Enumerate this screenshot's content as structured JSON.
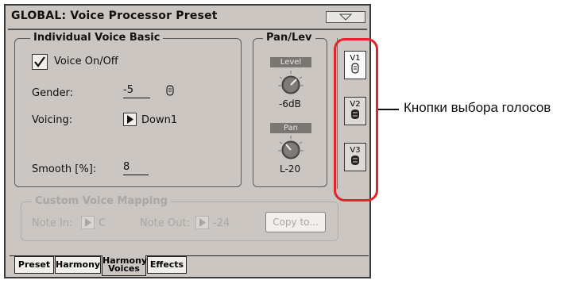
{
  "window": {
    "title": "GLOBAL: Voice Processor Preset",
    "menu_icon": "triangle-down-icon"
  },
  "voice_basic": {
    "title": "Individual Voice Basic",
    "voice_on_off": {
      "label": "Voice On/Off",
      "checked": true
    },
    "gender": {
      "label": "Gender:",
      "value": "-5",
      "icon": "face-icon"
    },
    "voicing": {
      "label": "Voicing:",
      "value": "Down1"
    },
    "smooth": {
      "label": "Smooth [%]:",
      "value": "8"
    }
  },
  "pan_lev": {
    "title": "Pan/Lev",
    "level": {
      "label": "Level",
      "value": "-6dB"
    },
    "pan": {
      "label": "Pan",
      "value": "L-20"
    }
  },
  "custom_mapping": {
    "title": "Custom Voice Mapping",
    "note_in": {
      "label": "Note In:",
      "value": "C"
    },
    "note_out": {
      "label": "Note Out:",
      "value": "-24"
    },
    "copy_button": "Copy to..."
  },
  "voice_buttons": [
    {
      "label": "V1",
      "selected": true
    },
    {
      "label": "V2",
      "selected": false
    },
    {
      "label": "V3",
      "selected": false
    }
  ],
  "tabs": [
    {
      "label": "Preset",
      "selected": false
    },
    {
      "label": "Harmony",
      "selected": false
    },
    {
      "label_line1": "Harmony",
      "label_line2": "Voices",
      "selected": true
    },
    {
      "label": "Effects",
      "selected": false
    }
  ],
  "callout": {
    "text": "Кнопки выбора голосов"
  },
  "colors": {
    "panel": "#cbc6c1",
    "highlight": "#e1232b"
  }
}
